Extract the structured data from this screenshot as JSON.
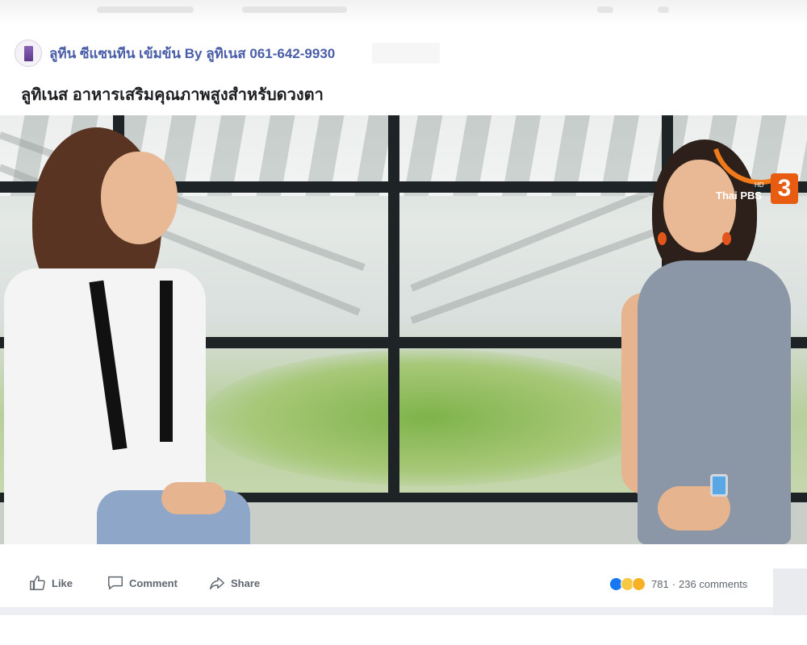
{
  "post": {
    "page_name": "ลูทีน ซีแซนทีน เข้มข้น By ลูทิเนส 061-642-9930",
    "title": "ลูทิเนส อาหารเสริมคุณภาพสูงสำหรับดวงตา"
  },
  "video": {
    "channel_logo": {
      "brand": "Thai PBS",
      "hd": "HD",
      "channel_number": "3"
    }
  },
  "actions": {
    "like_label": "Like",
    "comment_label": "Comment",
    "share_label": "Share"
  },
  "stats": {
    "reaction_icons": [
      "like-icon",
      "haha-icon",
      "wow-icon"
    ],
    "reactions_count": "781",
    "separator": "·",
    "comments_count": "236 comments"
  },
  "colors": {
    "page_name": "#4a5ea8",
    "action_text": "#606770",
    "like_blue": "#1877f2",
    "logo_orange": "#e85c12"
  }
}
